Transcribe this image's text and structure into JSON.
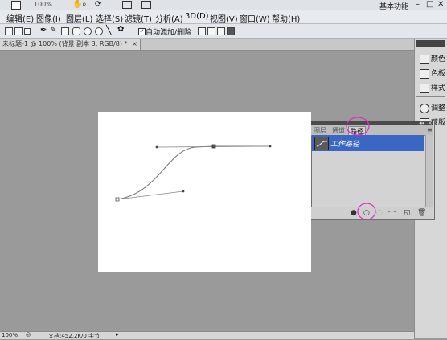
{
  "app": {
    "zoom_dropdown": "100%",
    "workspace": "基本功能",
    "window_controls": [
      "–",
      "□",
      "✕"
    ]
  },
  "menu": [
    "编辑(E)",
    "图像(I)",
    "图层(L)",
    "选择(S)",
    "滤镜(T)",
    "分析(A)",
    "3D(D)",
    "视图(V)",
    "窗口(W)",
    "帮助(H)"
  ],
  "options_bar": {
    "auto_add_delete_label": "自动添加/删除",
    "auto_add_delete_checked": true
  },
  "document_tab": {
    "label": "未标题-1 @ 100% (背景 副本 3, RGB/8) *",
    "close": "×"
  },
  "dock": {
    "items": [
      {
        "label": "颜色",
        "icon": "palette-icon"
      },
      {
        "label": "色板",
        "icon": "swatches-icon"
      },
      {
        "label": "样式",
        "icon": "styles-icon"
      },
      {
        "label": "调整",
        "icon": "adjustments-icon"
      },
      {
        "label": "蒙版",
        "icon": "masks-icon"
      }
    ]
  },
  "paths_panel": {
    "tabs": [
      "图层",
      "通道",
      "路径"
    ],
    "active_tab": "路径",
    "paths": [
      {
        "name": "工作路径",
        "selected": true
      }
    ],
    "bottom_buttons": [
      "fill-path-icon",
      "stroke-path-icon",
      "load-selection-icon",
      "make-work-path-icon",
      "new-path-icon",
      "delete-path-icon"
    ]
  },
  "status_bar": {
    "zoom": "100%",
    "doc_info": "文档:452.2K/0 字节"
  },
  "colors": {
    "panel_selection": "#3b67c4",
    "annotation": "#e02cc8",
    "workspace_bg": "#9a9a9a"
  }
}
